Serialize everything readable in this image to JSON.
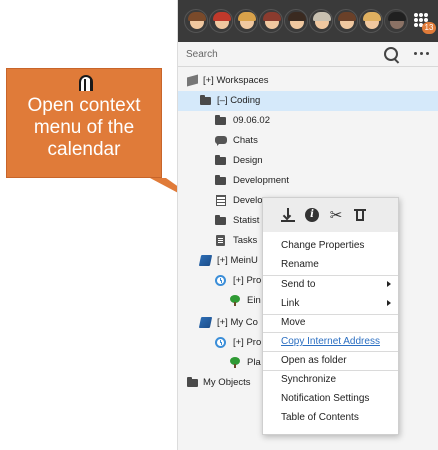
{
  "callout": {
    "mouse_icon": "mouse-right-click-icon",
    "text": "Open context menu of the calendar",
    "color": "#e07b39"
  },
  "avatars": {
    "users": [
      {
        "hair": "#7a4a2a",
        "online": true
      },
      {
        "hair": "#c0392b",
        "online": false
      },
      {
        "hair": "#d9a24a",
        "online": false
      },
      {
        "hair": "#8a3b2e",
        "online": false
      },
      {
        "hair": "#3a2a20",
        "online": false
      },
      {
        "hair": "#c8c0b0",
        "online": false
      },
      {
        "hair": "#6a4028",
        "online": false
      },
      {
        "hair": "#e0b060",
        "online": false
      },
      {
        "hair": "#1a1a1a",
        "online": false
      }
    ],
    "notification_count": "13"
  },
  "search": {
    "placeholder": "Search"
  },
  "tree": {
    "workspaces": "[+] Workspaces",
    "coding": "[–] Coding",
    "items": [
      "09.06.02",
      "Chats",
      "Design",
      "Development",
      "Develo",
      "Statist",
      "Tasks"
    ],
    "meinu": "[+] MeinU",
    "meinu_child": "[+] Pro",
    "meinu_leaf": "Ein",
    "mycomp": "[+] My Co",
    "mycomp_child": "[+] Pro",
    "mycomp_leaf": "Pla",
    "my_objects": "My Objects"
  },
  "context_menu": {
    "toolbar_icons": [
      "download-icon",
      "info-icon",
      "scissors-icon",
      "trash-icon"
    ],
    "items": {
      "change_properties": "Change Properties",
      "rename": "Rename",
      "send_to": "Send to",
      "link": "Link",
      "move": "Move",
      "copy_address": "Copy Internet Address",
      "open_as_folder": "Open as folder",
      "synchronize": "Synchronize",
      "notification_settings": "Notification Settings",
      "table_of_contents": "Table of Contents"
    }
  },
  "colors": {
    "selection": "#d5e9fa",
    "link": "#2b6fc2",
    "accent": "#e07b39"
  }
}
